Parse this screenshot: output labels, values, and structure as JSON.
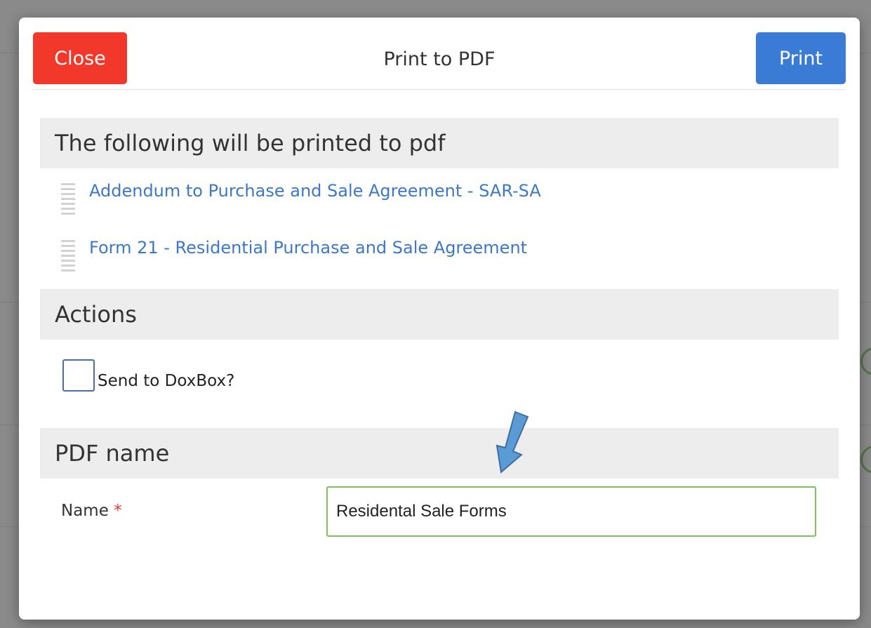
{
  "modal": {
    "title": "Print to PDF",
    "close_label": "Close",
    "print_label": "Print"
  },
  "documents_section": {
    "heading": "The following will be printed to pdf",
    "items": [
      {
        "label": "Addendum to Purchase and Sale Agreement - SAR-SA"
      },
      {
        "label": "Form 21 - Residential Purchase and Sale Agreement"
      }
    ]
  },
  "actions_section": {
    "heading": "Actions",
    "send_to_doxbox_label": "Send to DoxBox?",
    "send_to_doxbox_checked": false
  },
  "pdf_name_section": {
    "heading": "PDF name",
    "name_label": "Name",
    "required_marker": "*",
    "name_value": "Residental Sale Forms"
  },
  "colors": {
    "close_button": "#f2382b",
    "print_button": "#3a7bd5",
    "link": "#3d78c8",
    "input_border_valid": "#7cc35a",
    "arrow_fill": "#5b9bd5"
  },
  "icons": {
    "drag_handle": "drag-handle-icon",
    "annotation_arrow": "down-arrow-annotation"
  }
}
